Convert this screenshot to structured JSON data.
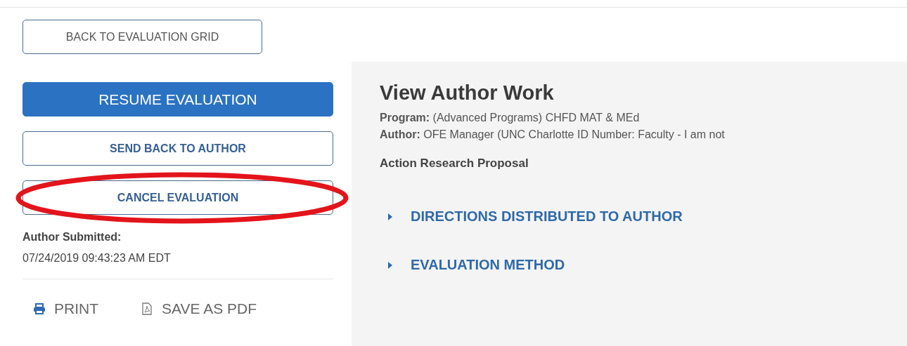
{
  "back_button": "BACK TO EVALUATION GRID",
  "actions": [
    {
      "label": "RESUME EVALUATION",
      "kind": "primary",
      "highlighted": false
    },
    {
      "label": "SEND BACK TO AUTHOR",
      "kind": "outline",
      "highlighted": false
    },
    {
      "label": "CANCEL EVALUATION",
      "kind": "outline",
      "highlighted": true
    }
  ],
  "submitted": {
    "label": "Author Submitted:",
    "value": "07/24/2019 09:43:23 AM EDT"
  },
  "tools": [
    {
      "label": "PRINT",
      "kind": "print"
    },
    {
      "label": "SAVE AS PDF",
      "kind": "pdf"
    }
  ],
  "main": {
    "title": "View Author Work",
    "meta": [
      "**Program:** (Advanced Programs) CHFD MAT & MEd",
      "**Author:** OFE Manager (UNC Charlotte ID Number: Faculty - I am not"
    ],
    "section": "Action Research Proposal",
    "sections": [
      {
        "label": "DIRECTIONS DISTRIBUTED TO AUTHOR",
        "expanded": false
      },
      {
        "label": "EVALUATION METHOD",
        "expanded": false
      }
    ]
  }
}
